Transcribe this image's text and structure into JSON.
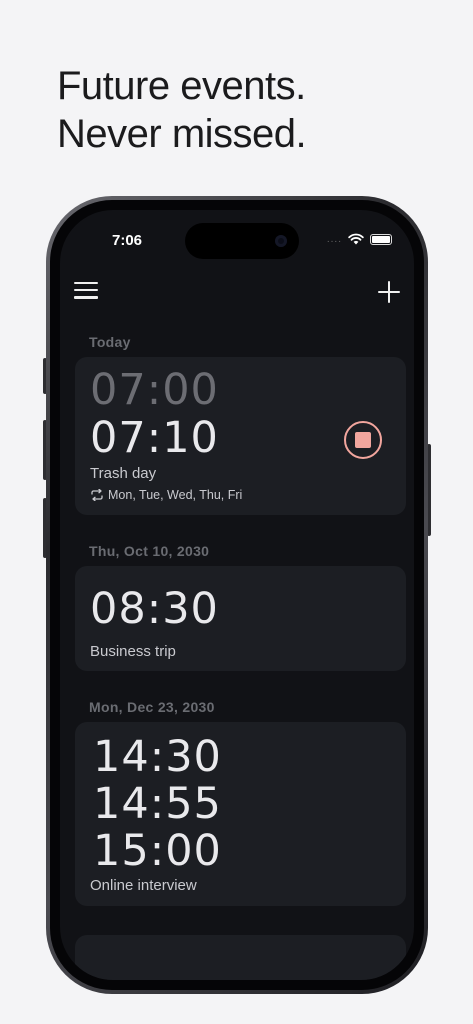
{
  "headline": {
    "line1": "Future events.",
    "line2": "Never missed."
  },
  "status_bar": {
    "time": "7:06",
    "signal": "....",
    "wifi_icon": "wifi-icon",
    "battery_icon": "battery-icon"
  },
  "toolbar": {
    "menu_icon": "hamburger-menu-icon",
    "add_icon": "plus-icon"
  },
  "sections": [
    {
      "header": "Today",
      "cards": [
        {
          "times": [
            "07:00",
            "07:10"
          ],
          "title": "Trash day",
          "repeat": "Mon, Tue, Wed, Thu, Fri",
          "action_icon": "stop-icon"
        }
      ]
    },
    {
      "header": "Thu, Oct 10, 2030",
      "cards": [
        {
          "times": [
            "08:30"
          ],
          "title": "Business trip"
        }
      ]
    },
    {
      "header": "Mon, Dec 23, 2030",
      "cards": [
        {
          "times": [
            "14:30",
            "14:55",
            "15:00"
          ],
          "title": "Online interview"
        }
      ]
    }
  ],
  "colors": {
    "background": "#f4f4f6",
    "screen": "#111216",
    "card": "#1c1e23",
    "accent_stop": "#f2a69e",
    "time_dim": "#6c6d73",
    "time_bright": "#e9e9ec"
  }
}
